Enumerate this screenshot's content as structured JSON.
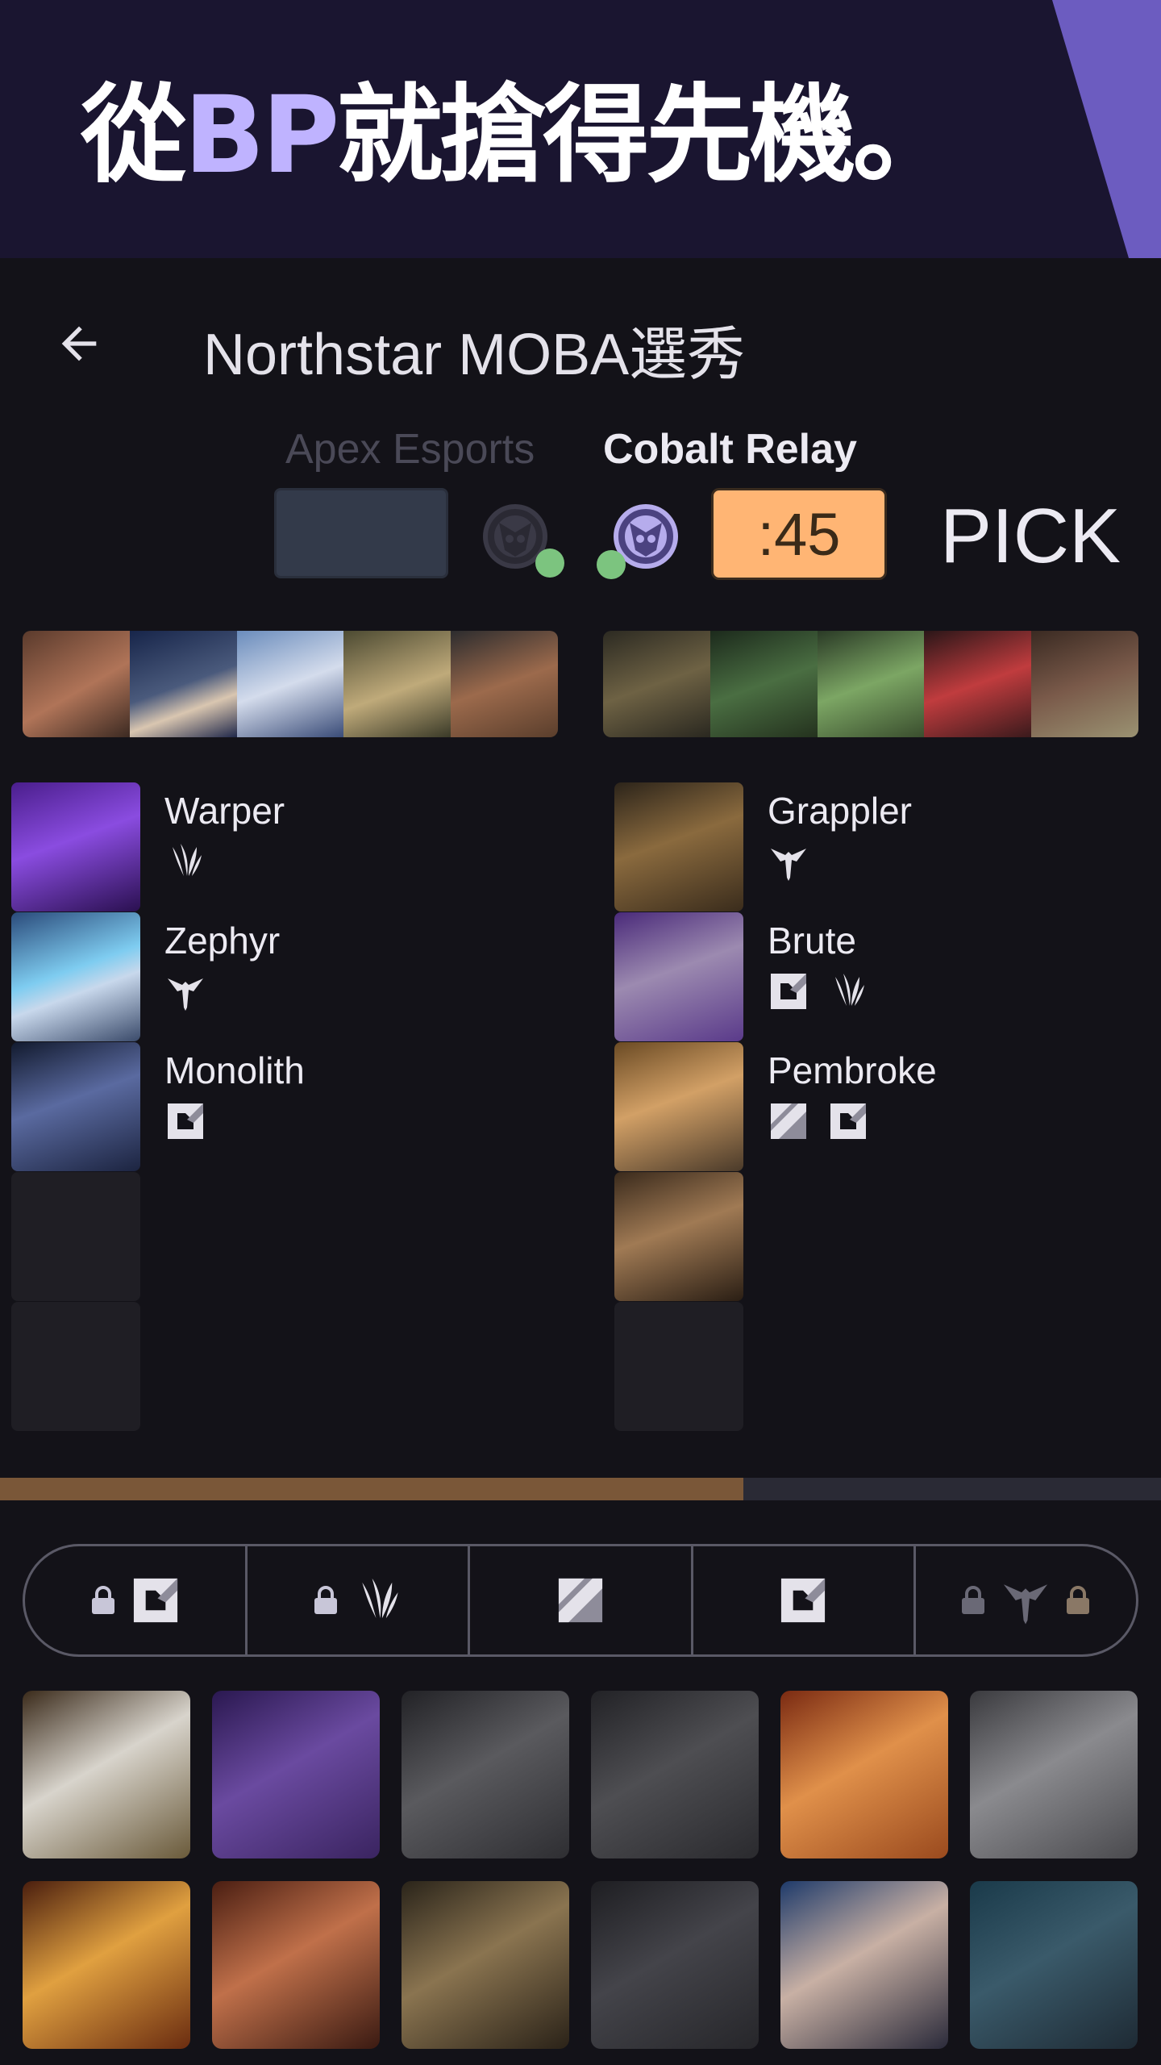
{
  "banner": {
    "headline_pre": "從",
    "headline_accent": "BP",
    "headline_post": "就搶得先機。"
  },
  "header": {
    "title": "Northstar MOBA選秀"
  },
  "draft": {
    "team_a": {
      "name": "Apex Esports"
    },
    "team_b": {
      "name": "Cobalt Relay"
    },
    "timer": ":45",
    "phase": "PICK",
    "progress": 0.64
  },
  "picks": {
    "team_a": [
      {
        "name": "Warper",
        "roles": [
          "claw-icon"
        ]
      },
      {
        "name": "Zephyr",
        "roles": [
          "trident-icon"
        ]
      },
      {
        "name": "Monolith",
        "roles": [
          "square-icon"
        ]
      },
      {
        "name": "",
        "roles": []
      },
      {
        "name": "",
        "roles": []
      }
    ],
    "team_b": [
      {
        "name": "Grappler",
        "roles": [
          "trident-icon"
        ]
      },
      {
        "name": "Brute",
        "roles": [
          "square-icon",
          "claw-icon"
        ]
      },
      {
        "name": "Pembroke",
        "roles": [
          "slash-icon",
          "square-icon"
        ]
      },
      {
        "name": "",
        "roles": []
      },
      {
        "name": "",
        "roles": []
      }
    ]
  },
  "role_filter": [
    "square-icon",
    "claw-icon",
    "slash-icon",
    "square-icon",
    "trident-icon"
  ],
  "colors": {
    "banner_bg": "#1A1530",
    "accent": "#BFB3FF",
    "timer_bg": "#FFB574",
    "progress": "#7A5738",
    "status_dot": "#7CC47F"
  }
}
